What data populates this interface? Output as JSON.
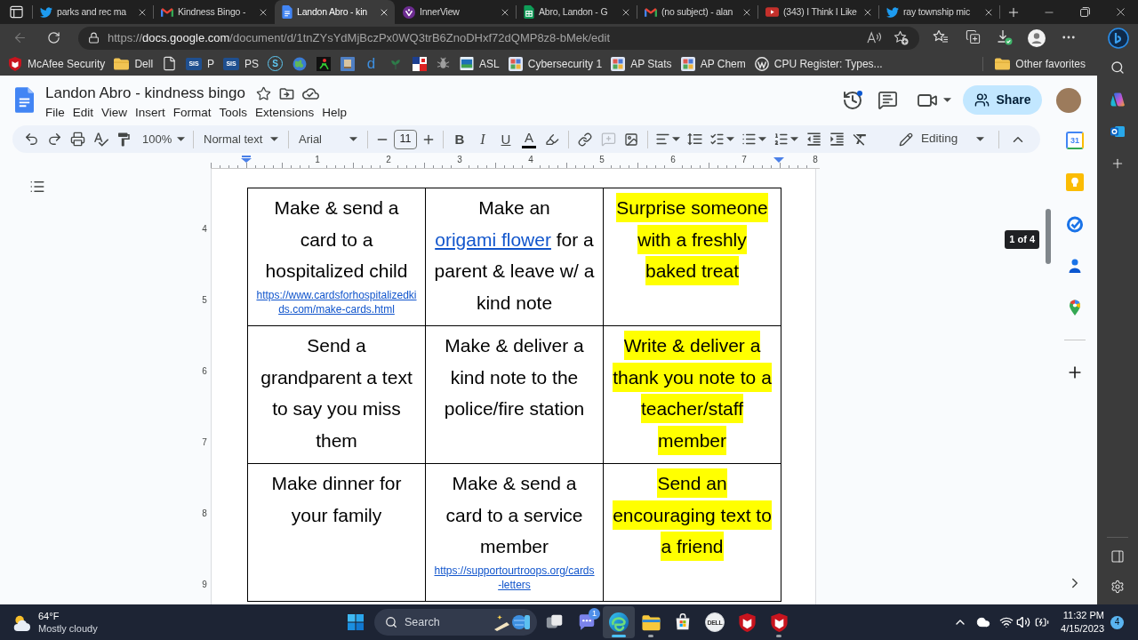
{
  "tabs": [
    {
      "kind": "bird",
      "title": "parks and rec ma",
      "selected": false
    },
    {
      "kind": "mail",
      "title": "Kindness Bingo -",
      "selected": false
    },
    {
      "kind": "doc",
      "title": "Landon Abro - kin",
      "selected": true
    },
    {
      "kind": "ring",
      "title": "InnerView",
      "selected": false
    },
    {
      "kind": "sheet",
      "title": "Abro, Landon - G",
      "selected": false
    },
    {
      "kind": "mail",
      "title": "(no subject) - alan",
      "selected": false
    },
    {
      "kind": "video",
      "title": "(343) I Think I Like",
      "selected": false
    },
    {
      "kind": "bird",
      "title": "ray township mic",
      "selected": false
    }
  ],
  "address_bar": {
    "back_disabled": true,
    "url": {
      "scheme": "https://",
      "host": "docs.google.com",
      "path": "/document/d/1tnZYsYdMjBczPx0WQ3trB6ZnoDHxf72dQMP8z8-bMek/edit"
    }
  },
  "favorites": {
    "items": [
      {
        "kind": "shield",
        "label": "McAfee Security"
      },
      {
        "kind": "folder",
        "label": "Dell"
      },
      {
        "kind": "page"
      },
      {
        "kind": "badge",
        "badge": "SIS",
        "label": "P"
      },
      {
        "kind": "badge",
        "badge": "SIS",
        "label": "PS"
      },
      {
        "kind": "ring_letter",
        "badge": "S"
      },
      {
        "kind": "globe"
      },
      {
        "kind": "figure"
      },
      {
        "kind": "picture"
      },
      {
        "kind": "letter",
        "badge": "d"
      },
      {
        "kind": "sprout"
      },
      {
        "kind": "flag"
      },
      {
        "kind": "bug"
      },
      {
        "kind": "tile",
        "label": "ASL"
      },
      {
        "kind": "grid",
        "label": "Cybersecurity 1"
      },
      {
        "kind": "grid",
        "label": "AP Stats"
      },
      {
        "kind": "grid",
        "label": "AP Chem"
      },
      {
        "kind": "wp",
        "label": "CPU Register: Types..."
      }
    ],
    "other": "Other favorites"
  },
  "docs": {
    "title": "Landon Abro - kindness bingo",
    "menu": [
      "File",
      "Edit",
      "View",
      "Insert",
      "Format",
      "Tools",
      "Extensions",
      "Help"
    ],
    "share": "Share",
    "toolbar": {
      "zoom": "100%",
      "style": "Normal text",
      "font": "Arial",
      "font_size": "11",
      "text_buttons": [
        {
          "kind": "bold",
          "label": "B"
        },
        {
          "kind": "italic",
          "label": "I"
        },
        {
          "kind": "underline",
          "label": "U"
        },
        {
          "kind": "color",
          "label": "A"
        }
      ],
      "add_comment_disabled": true,
      "mode": "Editing"
    },
    "ruler": [
      "1",
      "2",
      "3",
      "4",
      "5",
      "6",
      "7",
      "8"
    ],
    "vertical_ruler": [
      "4",
      "5",
      "6",
      "7",
      "8",
      "9"
    ],
    "page_indicator": "1 of 4",
    "table": {
      "rows": [
        {
          "cells": [
            {
              "parts": [
                {
                  "kind": "text",
                  "text": "Make & send a card to a hospitalized child"
                }
              ],
              "highlighted": false,
              "url": "https://www.cardsforhospitalizedkids.com/make-cards.html"
            },
            {
              "parts": [
                {
                  "kind": "text",
                  "text": "Make an "
                },
                {
                  "kind": "link",
                  "text": "origami flower"
                },
                {
                  "kind": "text",
                  "text": " for a parent & leave w/ a kind note"
                }
              ],
              "highlighted": false
            },
            {
              "parts": [
                {
                  "kind": "text",
                  "text": "Surprise someone with a freshly baked treat"
                }
              ],
              "highlighted": true
            }
          ]
        },
        {
          "cells": [
            {
              "parts": [
                {
                  "kind": "text",
                  "text": "Send a grandparent a text to say you miss them"
                }
              ],
              "highlighted": false
            },
            {
              "parts": [
                {
                  "kind": "text",
                  "text": "Make & deliver a kind note to the police/fire station"
                }
              ],
              "highlighted": false
            },
            {
              "parts": [
                {
                  "kind": "text",
                  "text": "Write & deliver a thank you note to a teacher/staff member"
                }
              ],
              "highlighted": true
            }
          ]
        },
        {
          "cells": [
            {
              "parts": [
                {
                  "kind": "text",
                  "text": "Make dinner for your family"
                }
              ],
              "highlighted": false
            },
            {
              "parts": [
                {
                  "kind": "text",
                  "text": "Make & send a card to a service member"
                }
              ],
              "highlighted": false,
              "url": "https://supportourtroops.org/cards-letters"
            },
            {
              "parts": [
                {
                  "kind": "text",
                  "text": "Send an encouraging text to a friend"
                }
              ],
              "highlighted": true
            }
          ]
        }
      ]
    },
    "side_panel": {
      "calendar_day": "31"
    }
  },
  "taskbar": {
    "weather": {
      "temperature": "64°F",
      "condition": "Mostly cloudy"
    },
    "search_placeholder": "Search",
    "apps": [
      {
        "kind": "task_view",
        "running": false,
        "active": false
      },
      {
        "kind": "chat",
        "badge": "1",
        "running": false,
        "active": false
      },
      {
        "kind": "browser",
        "running": true,
        "active": true
      },
      {
        "kind": "folder",
        "running": true,
        "active": false
      },
      {
        "kind": "store",
        "running": false,
        "active": false
      },
      {
        "kind": "dell",
        "badge": "DELL",
        "running": false,
        "active": false
      },
      {
        "kind": "shield",
        "running": false,
        "active": false
      },
      {
        "kind": "shield",
        "running": true,
        "active": false
      }
    ],
    "time": "11:32 PM",
    "date": "4/15/2023",
    "notification_count": "4"
  }
}
